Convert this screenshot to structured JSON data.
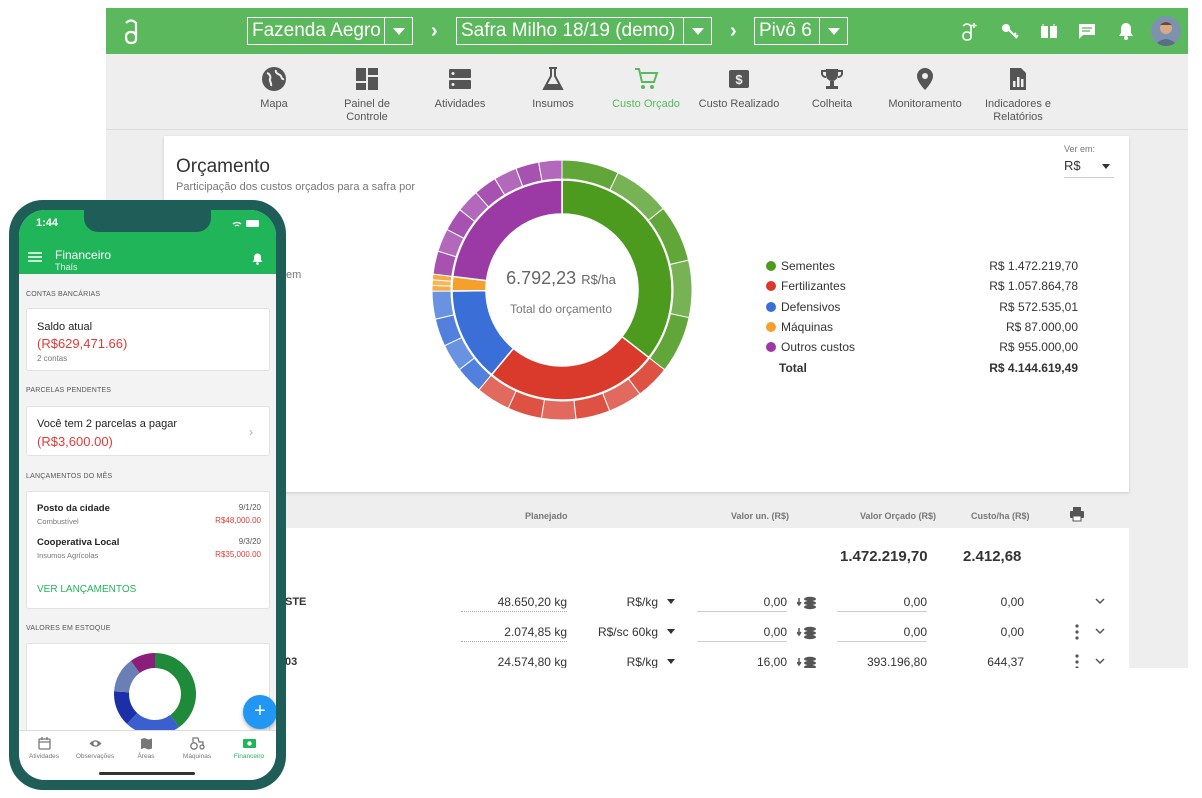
{
  "header": {
    "farm": "Fazenda Aegro",
    "season": "Safra Milho 18/19 (demo)",
    "pivot": "Pivô 6"
  },
  "nav": [
    {
      "label": "Mapa",
      "icon": "globe-icon"
    },
    {
      "label": "Painel de Controle",
      "icon": "dashboard-icon"
    },
    {
      "label": "Atividades",
      "icon": "activities-icon"
    },
    {
      "label": "Insumos",
      "icon": "flask-icon"
    },
    {
      "label": "Custo Orçado",
      "icon": "cart-icon",
      "active": true
    },
    {
      "label": "Custo Realizado",
      "icon": "money-icon"
    },
    {
      "label": "Colheita",
      "icon": "trophy-icon"
    },
    {
      "label": "Monitoramento",
      "icon": "pin-icon"
    },
    {
      "label": "Indicadores e Relatórios",
      "icon": "report-icon"
    }
  ],
  "budget": {
    "title": "Orçamento",
    "subtitle": "Participação dos custos orçados para a safra por",
    "fragment": "em",
    "view_label": "Ver em:",
    "view_value": "R$",
    "center_value": "6.792,23",
    "center_unit": "R$/ha",
    "center_label": "Total do orçamento"
  },
  "chart_data": {
    "type": "pie",
    "title": "Orçamento",
    "categories": [
      "Sementes",
      "Fertilizantes",
      "Defensivos",
      "Máquinas",
      "Outros custos"
    ],
    "values": [
      1472219.7,
      1057864.78,
      572535.01,
      87000.0,
      955000.0
    ],
    "colors": [
      "#4c9a1e",
      "#d93a2b",
      "#3a6fd8",
      "#f5a02a",
      "#9b3aa5"
    ],
    "total": 4144619.49,
    "center_text": "6.792,23 R$/ha"
  },
  "legend": {
    "items": [
      {
        "name": "Sementes",
        "value": "R$ 1.472.219,70",
        "color": "#4c9a1e"
      },
      {
        "name": "Fertilizantes",
        "value": "R$ 1.057.864,78",
        "color": "#d93a2b"
      },
      {
        "name": "Defensivos",
        "value": "R$ 572.535,01",
        "color": "#3a6fd8"
      },
      {
        "name": "Máquinas",
        "value": "R$ 87.000,00",
        "color": "#f5a02a"
      },
      {
        "name": "Outros custos",
        "value": "R$ 955.000,00",
        "color": "#9b3aa5"
      }
    ],
    "total_label": "Total",
    "total_value": "R$ 4.144.619,49"
  },
  "table": {
    "headers": {
      "planejado": "Planejado",
      "valor_un": "Valor un. (R$)",
      "valor_orcado": "Valor Orçado (R$)",
      "custo_ha": "Custo/ha  (R$)"
    },
    "group_total": "1.472.219,70",
    "group_per_ha": "2.412,68",
    "rows": [
      {
        "label": "STE",
        "qty": "48.650,20 kg",
        "unit": "R$/kg",
        "unit_value": "0,00",
        "budget": "0,00",
        "per_ha": "0,00"
      },
      {
        "label": "",
        "qty": "2.074,85 kg",
        "unit": "R$/sc 60kg",
        "unit_value": "0,00",
        "budget": "0,00",
        "per_ha": "0,00"
      },
      {
        "label": "03",
        "qty": "24.574,80 kg",
        "unit": "R$/kg",
        "unit_value": "16,00",
        "budget": "393.196,80",
        "per_ha": "644,37"
      }
    ]
  },
  "phone": {
    "time": "1:44",
    "title": "Financeiro",
    "user": "Thaís",
    "bank_section": "CONTAS BANCÁRIAS",
    "balance_label": "Saldo atual",
    "balance_value": "(R$629,471.66)",
    "accounts": "2 contas",
    "pending_section": "PARCELAS PENDENTES",
    "pending_text": "Você tem 2 parcelas a pagar",
    "pending_value": "(R$3,600.00)",
    "month_section": "LANÇAMENTOS DO MÊS",
    "entries": [
      {
        "name": "Posto da cidade",
        "date": "9/1/20",
        "category": "Combustível",
        "value": "R$48,000.00"
      },
      {
        "name": "Cooperativa Local",
        "date": "9/3/20",
        "category": "Insumos Agrícolas",
        "value": "R$35,000.00"
      }
    ],
    "see_all": "VER LANÇAMENTOS",
    "stock_section": "VALORES EM ESTOQUE",
    "tabs": [
      {
        "label": "Atividades"
      },
      {
        "label": "Observações"
      },
      {
        "label": "Áreas"
      },
      {
        "label": "Máquinas"
      },
      {
        "label": "Financeiro"
      }
    ]
  }
}
